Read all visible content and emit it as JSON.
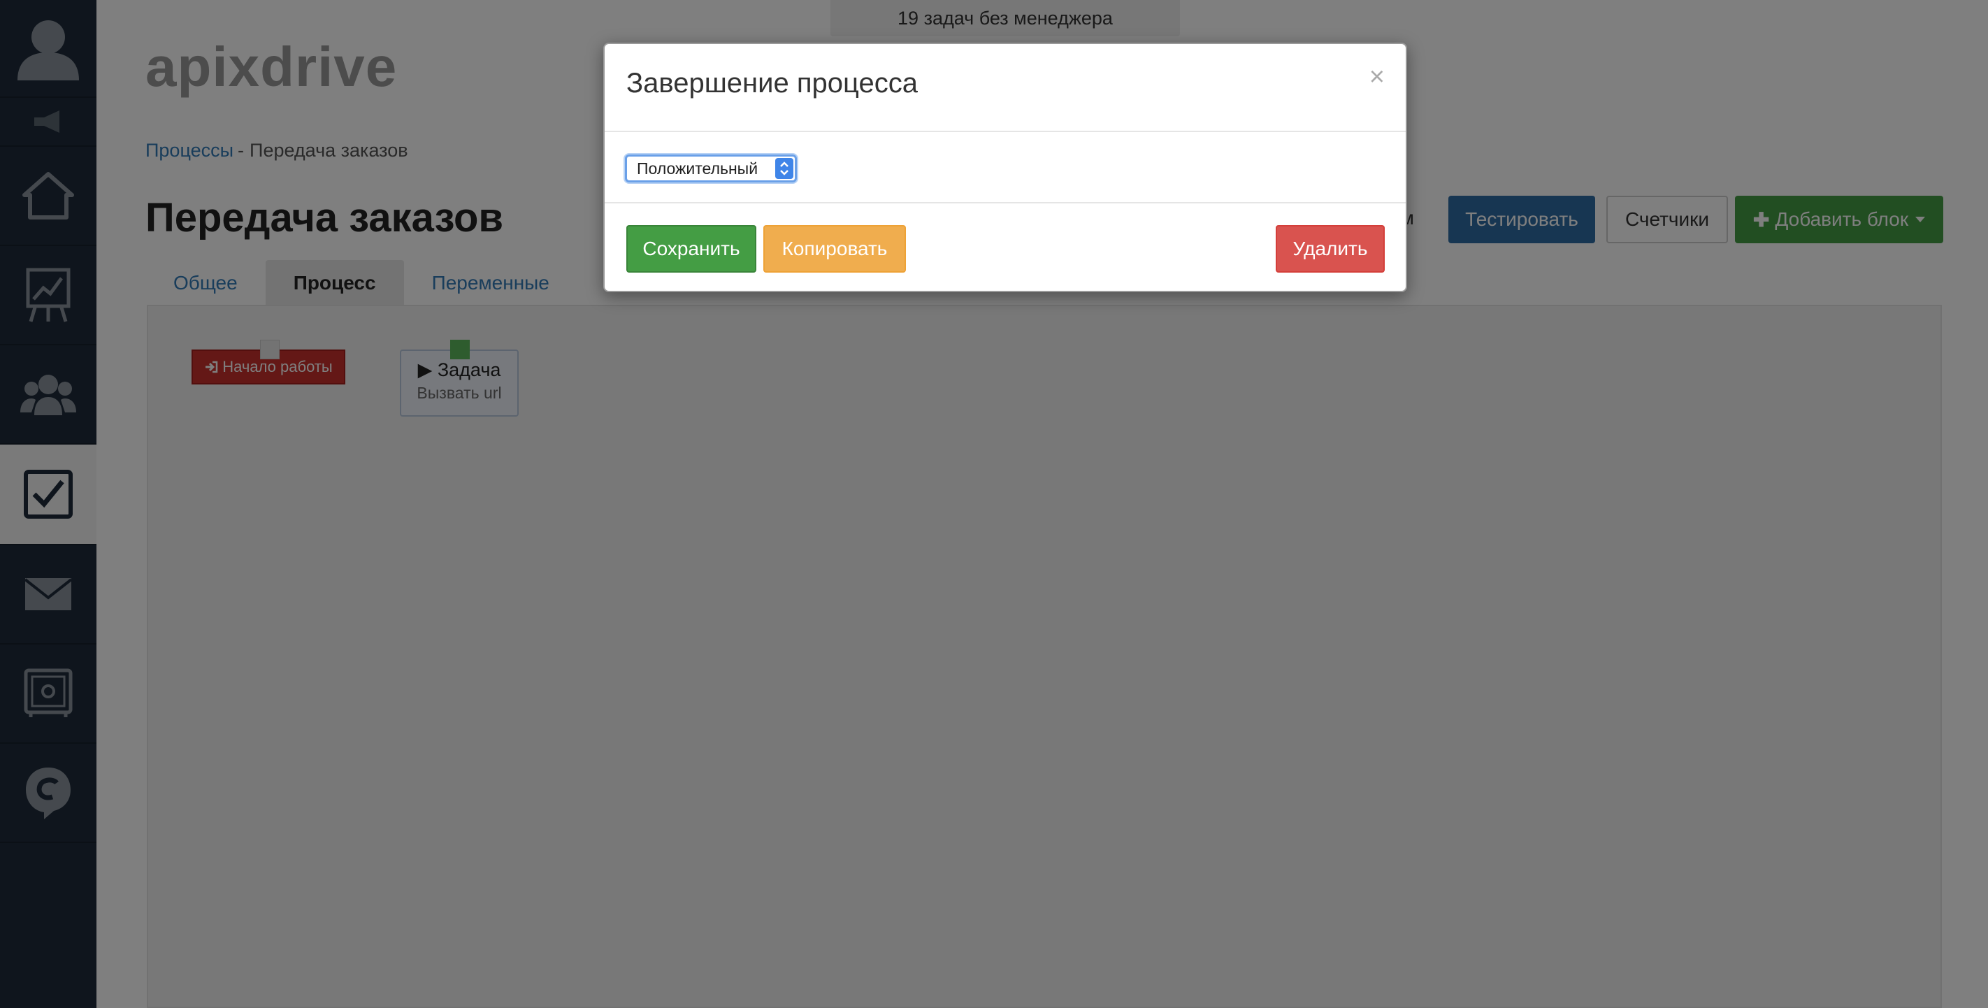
{
  "sidebar": {
    "items": [
      {
        "icon": "user-avatar-icon"
      },
      {
        "icon": "megaphone-icon"
      },
      {
        "icon": "home-icon"
      },
      {
        "icon": "chart-icon"
      },
      {
        "icon": "users-icon"
      },
      {
        "icon": "checkbox-icon"
      },
      {
        "icon": "mail-icon"
      },
      {
        "icon": "safe-icon"
      },
      {
        "icon": "chat-icon"
      }
    ]
  },
  "header": {
    "notice": "19 задач без менеджера",
    "logo": "apixdrive"
  },
  "breadcrumb": {
    "link": "Процессы",
    "separator": "-",
    "current": "Передача заказов"
  },
  "page": {
    "title": "Передача заказов",
    "partial_text": "ом",
    "buttons": {
      "test": "Тестировать",
      "counters": "Счетчики",
      "add_block": "Добавить блок"
    }
  },
  "tabs": [
    {
      "label": "Общее",
      "active": false
    },
    {
      "label": "Процесс",
      "active": true
    },
    {
      "label": "Переменные",
      "active": false
    }
  ],
  "canvas": {
    "start_node": {
      "label": "Начало работы"
    },
    "task_node": {
      "title": "Задача",
      "subtitle": "Вызвать url"
    }
  },
  "modal": {
    "title": "Завершение процесса",
    "close": "×",
    "select": {
      "value": "Положительный"
    },
    "buttons": {
      "save": "Сохранить",
      "copy": "Копировать",
      "delete": "Удалить"
    }
  },
  "colors": {
    "sidebar": "#1e2b3a",
    "primary": "#2e6da4",
    "success": "#449d44",
    "warning": "#f0ad4e",
    "danger": "#d9534f"
  }
}
